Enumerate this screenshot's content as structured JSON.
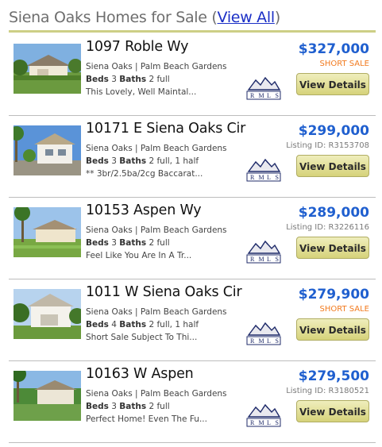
{
  "header": {
    "title": "Siena Oaks Homes for Sale ",
    "paren_open": "(",
    "view_all": "View All",
    "paren_close": ")"
  },
  "colors": {
    "price": "#1f5fcf",
    "short_sale": "#f27a1e",
    "accent_rule": "#cdcf86",
    "link": "#1b2fc6"
  },
  "listings": [
    {
      "address": "1097 Roble Wy",
      "location": "Siena Oaks | Palm Beach Gardens",
      "beds_label": "Beds",
      "beds": "3",
      "baths_label": "Baths",
      "baths": "2 full",
      "description": "This Lovely, Well Maintal...",
      "price": "$327,000",
      "status": "SHORT SALE",
      "status_type": "short",
      "button": "View Details",
      "logo_text": "RMLS"
    },
    {
      "address": "10171 E Siena Oaks Cir",
      "location": "Siena Oaks | Palm Beach Gardens",
      "beds_label": "Beds",
      "beds": "3",
      "baths_label": "Baths",
      "baths": "2 full, 1 half",
      "description": "** 3br/2.5ba/2cg Baccarat...",
      "price": "$299,000",
      "status": "Listing ID: R3153708",
      "status_type": "lid",
      "button": "View Details",
      "logo_text": "RMLS"
    },
    {
      "address": "10153 Aspen Wy",
      "location": "Siena Oaks | Palm Beach Gardens",
      "beds_label": "Beds",
      "beds": "3",
      "baths_label": "Baths",
      "baths": "2 full",
      "description": "Feel Like You Are In A Tr...",
      "price": "$289,000",
      "status": "Listing ID: R3226116",
      "status_type": "lid",
      "button": "View Details",
      "logo_text": "RMLS"
    },
    {
      "address": "1011 W Siena Oaks Cir",
      "location": "Siena Oaks | Palm Beach Gardens",
      "beds_label": "Beds",
      "beds": "4",
      "baths_label": "Baths",
      "baths": "2 full, 1 half",
      "description": "Short Sale Subject To Thi...",
      "price": "$279,900",
      "status": "SHORT SALE",
      "status_type": "short",
      "button": "View Details",
      "logo_text": "RMLS"
    },
    {
      "address": "10163 W Aspen",
      "location": "Siena Oaks | Palm Beach Gardens",
      "beds_label": "Beds",
      "beds": "3",
      "baths_label": "Baths",
      "baths": "2 full",
      "description": "Perfect Home! Even The Fu...",
      "price": "$279,500",
      "status": "Listing ID: R3180521",
      "status_type": "lid",
      "button": "View Details",
      "logo_text": "RMLS"
    }
  ]
}
